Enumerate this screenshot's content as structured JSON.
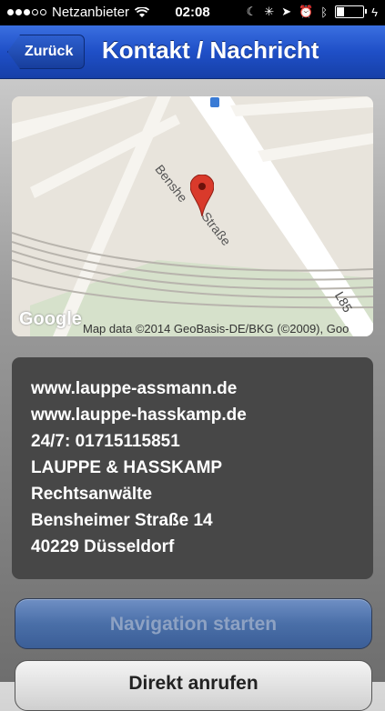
{
  "status_bar": {
    "carrier": "Netzanbieter",
    "time": "02:08",
    "signal_dots_filled": 3,
    "signal_dots_total": 5,
    "battery_level": 0.25,
    "icons": [
      "wifi-icon",
      "moon-icon",
      "spinner-icon",
      "location-arrow-icon",
      "alarm-icon",
      "bluetooth-icon",
      "battery-icon",
      "charging-bolt-icon"
    ]
  },
  "nav": {
    "back_label": "Zurück",
    "title": "Kontakt / Nachricht"
  },
  "map": {
    "street_label": "Bensheimer Straße",
    "street_label_part1": "Benshe",
    "street_label_part2": "Straße",
    "road_label": "L85",
    "google_logo": "Google",
    "attribution": "Map data ©2014 GeoBasis-DE/BKG (©2009), Goo"
  },
  "contact": {
    "lines": [
      "www.lauppe-assmann.de",
      "www.lauppe-hasskamp.de",
      "24/7: 01715115851",
      "LAUPPE & HASSKAMP",
      "Rechtsanwälte",
      "Bensheimer Straße 14",
      "40229 Düsseldorf"
    ]
  },
  "buttons": {
    "navigation_label": "Navigation starten",
    "call_label": "Direkt anrufen"
  },
  "colors": {
    "nav_blue": "#1f4fc7",
    "contact_bg": "#474747",
    "pin_red": "#d93a2b"
  }
}
